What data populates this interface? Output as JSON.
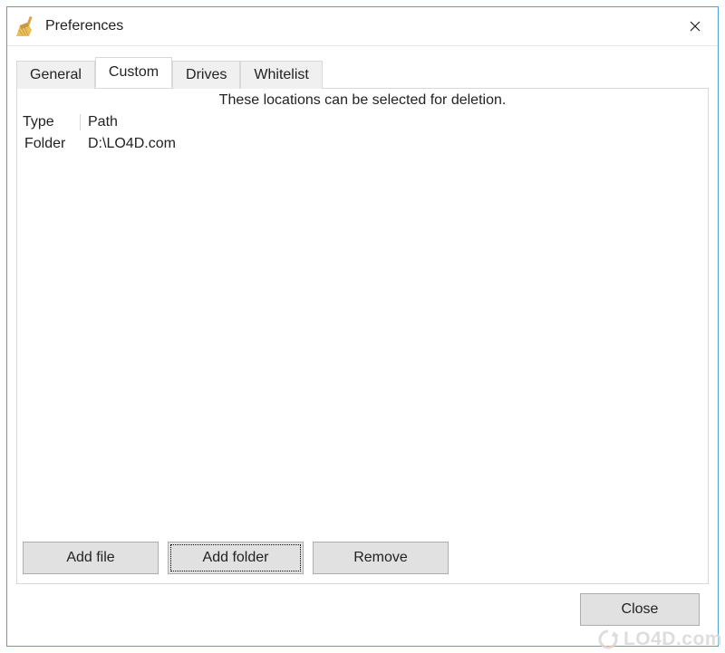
{
  "window": {
    "title": "Preferences"
  },
  "tabs": [
    {
      "label": "General"
    },
    {
      "label": "Custom"
    },
    {
      "label": "Drives"
    },
    {
      "label": "Whitelist"
    }
  ],
  "active_tab_index": 1,
  "panel": {
    "description": "These locations can be selected for deletion.",
    "columns": {
      "type": "Type",
      "path": "Path"
    },
    "rows": [
      {
        "type": "Folder",
        "path": "D:\\LO4D.com"
      }
    ]
  },
  "buttons": {
    "add_file": "Add file",
    "add_folder": "Add folder",
    "remove": "Remove",
    "close": "Close"
  },
  "watermark": "LO4D.com"
}
